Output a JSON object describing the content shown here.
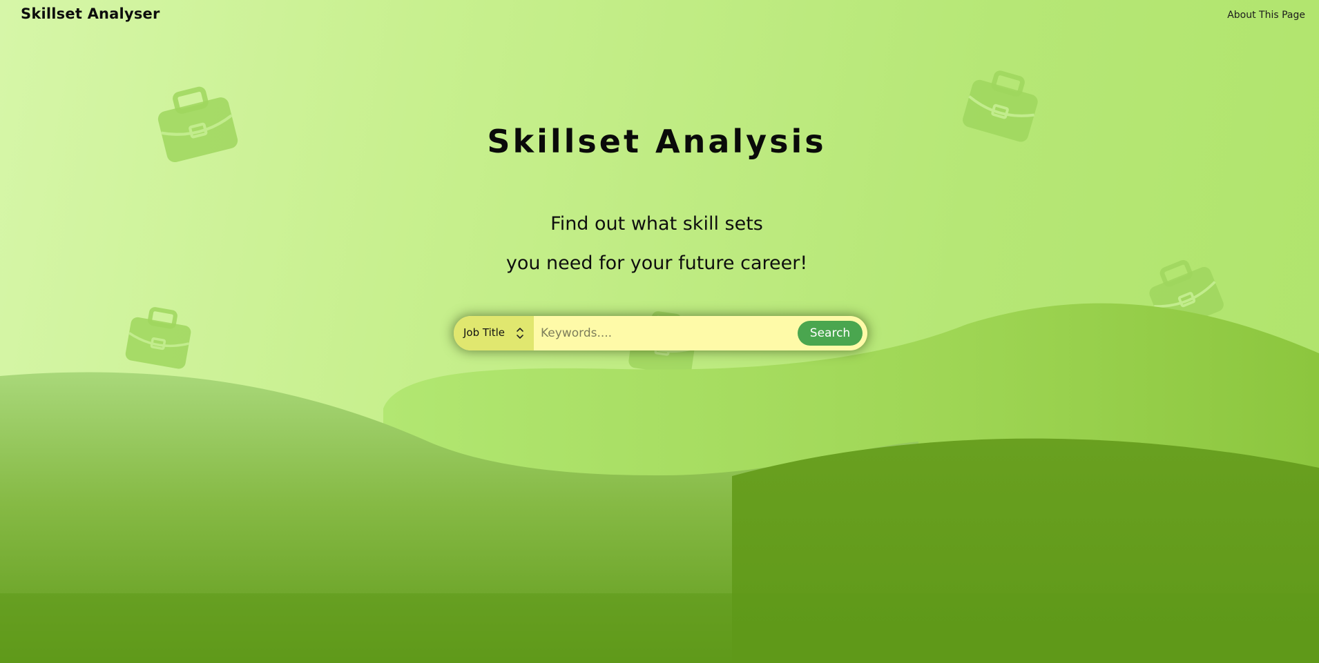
{
  "navbar": {
    "brand": "Skillset Analyser",
    "about_link": "About This Page"
  },
  "hero": {
    "title": "Skillset Analysis",
    "subtitle_line1": "Find out what skill sets",
    "subtitle_line2": "you need for your future career!"
  },
  "search": {
    "filter_selected": "Job Title",
    "input_value": "",
    "input_placeholder": "Keywords....",
    "button_label": "Search"
  },
  "icons": {
    "background_motif": "briefcase-icon",
    "select_indicator": "chevron-up-down-icon"
  },
  "colors": {
    "background_light": "#d6f6a8",
    "wave_dark": "#5f9919",
    "search_bar": "#fefaa8",
    "filter_bg": "#e0e76f",
    "search_button": "#4aa64f"
  }
}
